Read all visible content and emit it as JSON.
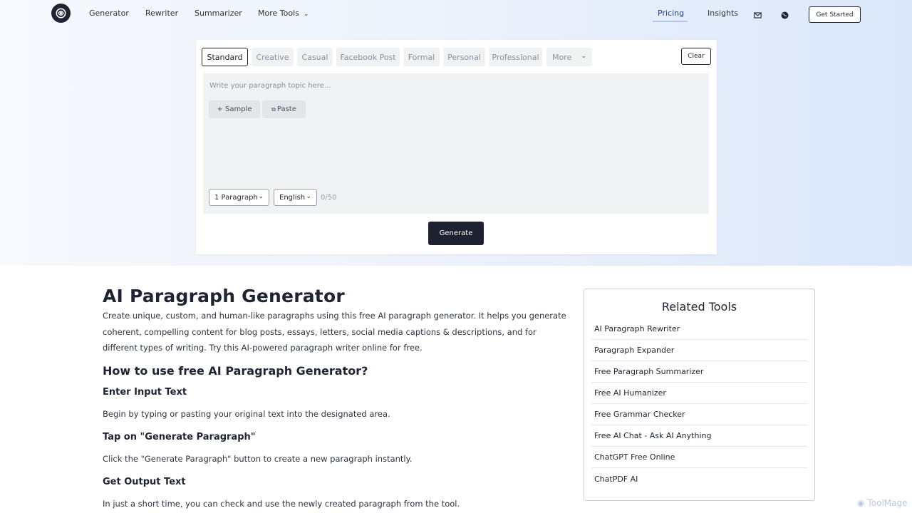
{
  "nav": {
    "links": [
      "Generator",
      "Rewriter",
      "Summarizer",
      "More Tools"
    ],
    "pricing": "Pricing",
    "insights": "Insights",
    "get_started": "Get Started"
  },
  "tool": {
    "tabs": [
      "Standard",
      "Creative",
      "Casual",
      "Facebook Post",
      "Formal",
      "Personal",
      "Professional",
      "More"
    ],
    "clear": "Clear",
    "placeholder": "Write your paragraph topic here...",
    "sample": "+ Sample",
    "paste": "Paste",
    "paragraph_select": "1 Paragraph",
    "language_select": "English",
    "counter": "0/50",
    "generate": "Generate"
  },
  "article": {
    "title": "AI Paragraph Generator",
    "intro": "Create unique, custom, and human-like paragraphs using this free AI paragraph generator. It helps you generate coherent, compelling content for blog posts, essays, letters, social media captions & descriptions, and for different types of writing. Try this AI-powered paragraph writer online for free.",
    "how_to_title": "How to use free AI Paragraph Generator?",
    "steps": [
      {
        "title": "Enter Input Text",
        "text": "Begin by typing or pasting your original text into the designated area."
      },
      {
        "title": "Tap on \"Generate Paragraph\"",
        "text": "Click the \"Generate Paragraph\" button to create a new paragraph instantly."
      },
      {
        "title": "Get Output Text",
        "text": "In just a short time, you can check and use the newly created paragraph from the tool."
      }
    ]
  },
  "related": {
    "title": "Related Tools",
    "items": [
      "AI Paragraph Rewriter",
      "Paragraph Expander",
      "Free Paragraph Summarizer",
      "Free AI Humanizer",
      "Free Grammar Checker",
      "Free AI Chat - Ask AI Anything",
      "ChatGPT Free Online",
      "ChatPDF AI"
    ]
  },
  "watermark": "ToolMage",
  "icons": [
    "logo-icon",
    "chevron-down-icon",
    "mail-icon",
    "globe-icon",
    "clipboard-icon"
  ],
  "colors": {
    "accent_dark": "#1e2130",
    "pricing_link": "#1f3f8f"
  }
}
